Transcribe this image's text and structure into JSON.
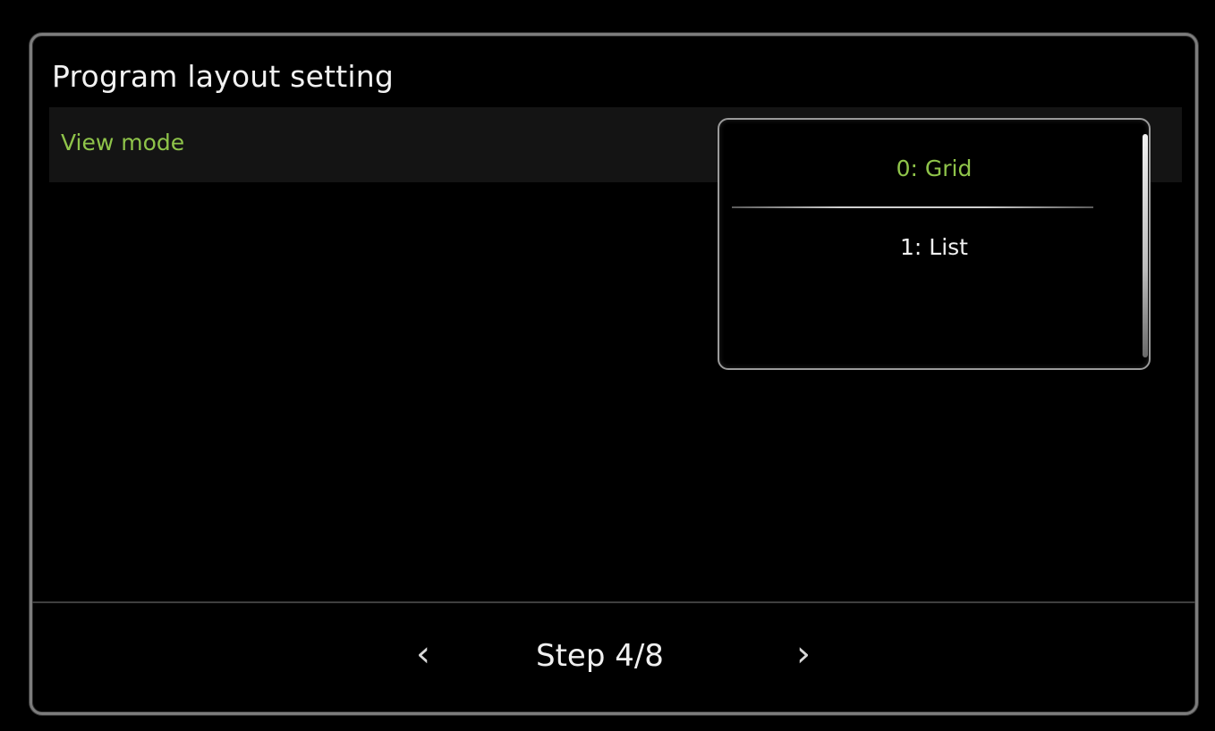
{
  "title": "Program layout setting",
  "setting": {
    "label": "View mode"
  },
  "dropdown": {
    "options": [
      {
        "label": "0: Grid",
        "selected": true
      },
      {
        "label": "1: List",
        "selected": false
      }
    ]
  },
  "footer": {
    "step_label": "Step 4/8",
    "prev_glyph": "‹",
    "next_glyph": "›"
  },
  "colors": {
    "background": "#000000",
    "accent_green": "#8fc44a",
    "text_white": "#f0f0f0",
    "frame_gray": "#7d7d7d"
  },
  "icons": {
    "prev": "chevron-left-icon",
    "next": "chevron-right-icon"
  }
}
